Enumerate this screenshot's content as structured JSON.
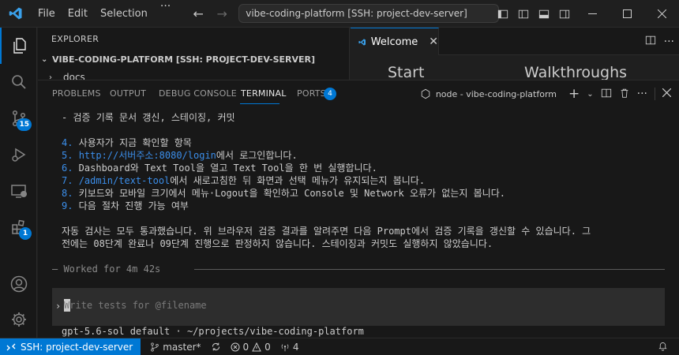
{
  "titlebar": {
    "menu": [
      "File",
      "Edit",
      "Selection"
    ],
    "more": "···",
    "search_text": "vibe-coding-platform [SSH: project-dev-server]",
    "window_controls": [
      "minimize-icon",
      "maximize-icon",
      "close-icon"
    ]
  },
  "activity_bar": {
    "items": [
      {
        "name": "explorer-icon"
      },
      {
        "name": "search-icon"
      },
      {
        "name": "source-control-icon",
        "badge": "15"
      },
      {
        "name": "run-debug-icon"
      },
      {
        "name": "remote-explorer-icon"
      },
      {
        "name": "extensions-icon",
        "badge": "1"
      },
      {
        "name": "account-icon"
      },
      {
        "name": "settings-gear-icon"
      }
    ]
  },
  "explorer": {
    "title": "EXPLORER",
    "folder": "VIBE-CODING-PLATFORM [SSH: PROJECT-DEV-SERVER]",
    "first_item": "docs"
  },
  "editor": {
    "tab_label": "Welcome",
    "start_heading": "Start",
    "walkthroughs_heading": "Walkthroughs"
  },
  "panel": {
    "tabs": [
      "PROBLEMS",
      "OUTPUT",
      "DEBUG CONSOLE",
      "TERMINAL",
      "PORTS"
    ],
    "active_tab": "TERMINAL",
    "ports_badge": "4",
    "terminal_name": "node - vibe-coding-platform",
    "add_label": "+"
  },
  "terminal": {
    "line0": "- 검증 기록 문서 갱신, 스테이징, 커밋",
    "item4_num": "4.",
    "item4_text": " 사용자가 지금 확인할 항목",
    "item5_num": "5.",
    "item5_link": "http://서버주소:8080/login",
    "item5_text": "에서 로그인합니다.",
    "item6_num": "6.",
    "item6_text": " Dashboard와 Text Tool을 열고 Text Tool을 한 번 실행합니다.",
    "item7_num": "7.",
    "item7_link": "/admin/text-tool",
    "item7_text": "에서 새로고침한 뒤 화면과 선택 메뉴가 유지되는지 봅니다.",
    "item8_num": "8.",
    "item8_text": " 키보드와 모바일 크기에서 메뉴·Logout을 확인하고 Console 및 Network 오류가 없는지 봅니다.",
    "item9_num": "9.",
    "item9_text": " 다음 절차 진행 가능 여부",
    "summary_1": "자동 검사는 모두 통과했습니다. 위 브라우저 검증 결과를 알려주면 다음 Prompt에서 검증 기록을 갱신할 수 있습니다. 그",
    "summary_2": "전에는 08단계 완료나 09단계 진행으로 판정하지 않습니다. 스테이징과 커밋도 실행하지 않았습니다.",
    "worked": "— Worked for 4m 42s",
    "prompt_caret": "›",
    "prompt_placeholder": "Write tests for @filename",
    "model_info": "gpt-5.6-sol default · ~/projects/vibe-coding-platform"
  },
  "statusbar": {
    "remote": "SSH: project-dev-server",
    "branch": "master*",
    "errors": "0",
    "warnings": "0",
    "ports": "4"
  },
  "colors": {
    "accent": "#0078d4",
    "link_blue": "#3b8eea",
    "background": "#1f1f1f"
  }
}
